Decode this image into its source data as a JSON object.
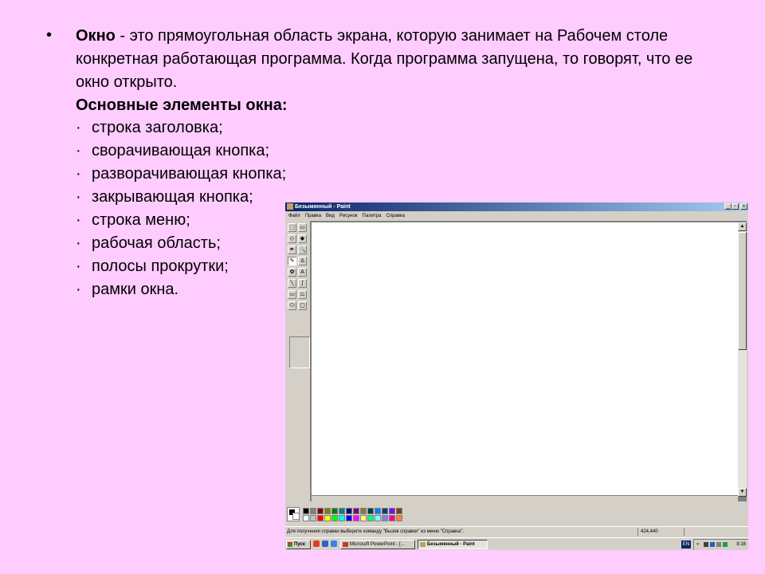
{
  "slide": {
    "bullet": "•",
    "term": "Окно",
    "definition": " - это прямоугольная область экрана, которую занимает на Рабочем столе конкретная работающая программа. Когда программа запущена, то говорят, что ее окно открыто.",
    "heading": "Основные элементы окна:",
    "item_marker": "·",
    "items": [
      "строка заголовка;",
      "сворачивающая кнопка;",
      "разворачивающая кнопка;",
      "закрывающая кнопка;",
      "строка меню;",
      "рабочая область;",
      "полосы прокрутки;",
      "рамки окна."
    ]
  },
  "paint": {
    "title": "Безымянный - Paint",
    "menu": [
      "Файл",
      "Правка",
      "Вид",
      "Рисунок",
      "Палитра",
      "Справка"
    ],
    "window_buttons": {
      "minimize": "_",
      "maximize": "▫",
      "close": "x"
    },
    "tools": [
      "free-select",
      "rect-select",
      "eraser",
      "fill",
      "color-picker",
      "magnifier",
      "pencil",
      "brush",
      "airbrush",
      "text",
      "line",
      "curve",
      "rectangle",
      "polygon",
      "ellipse",
      "rounded-rectangle"
    ],
    "tool_glyphs": [
      "⬚",
      "▭",
      "◇",
      "◆",
      "✒",
      "🔍",
      "✎",
      "♙",
      "✿",
      "A",
      "╲",
      "∫",
      "▭",
      "⏢",
      "⬭",
      "▢"
    ],
    "palette": [
      "#000000",
      "#808080",
      "#800000",
      "#808000",
      "#008000",
      "#008080",
      "#000080",
      "#800080",
      "#808040",
      "#004040",
      "#0080ff",
      "#004080",
      "#8000ff",
      "#804000",
      "#ffffff",
      "#c0c0c0",
      "#ff0000",
      "#ffff00",
      "#00ff00",
      "#00ffff",
      "#0000ff",
      "#ff00ff",
      "#ffff80",
      "#00ff80",
      "#80ffff",
      "#8080ff",
      "#ff0080",
      "#ff8040"
    ],
    "status_hint": "Для получения справки выберите команду \"Вызов справки\" из меню \"Справка\".",
    "status_coords": "424,440",
    "scroll_up": "▲",
    "scroll_down": "▼"
  },
  "taskbar": {
    "start_label": "Пуск",
    "buttons": [
      "Microsoft PowerPoint - [...",
      "Безымянный - Paint"
    ],
    "lang": "EN",
    "tray_arrows": "«",
    "clock": "8:16"
  }
}
